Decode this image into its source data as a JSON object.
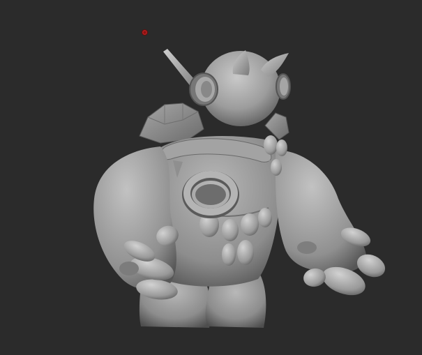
{
  "viewport": {
    "label": "",
    "background": "#2b2b2b"
  },
  "model": {
    "icon": "sculpted-creature-model",
    "material_color": "#9a9a9a"
  },
  "cursor": {
    "icon": "transpose-pivot-point-icon",
    "color": "#b32020"
  }
}
